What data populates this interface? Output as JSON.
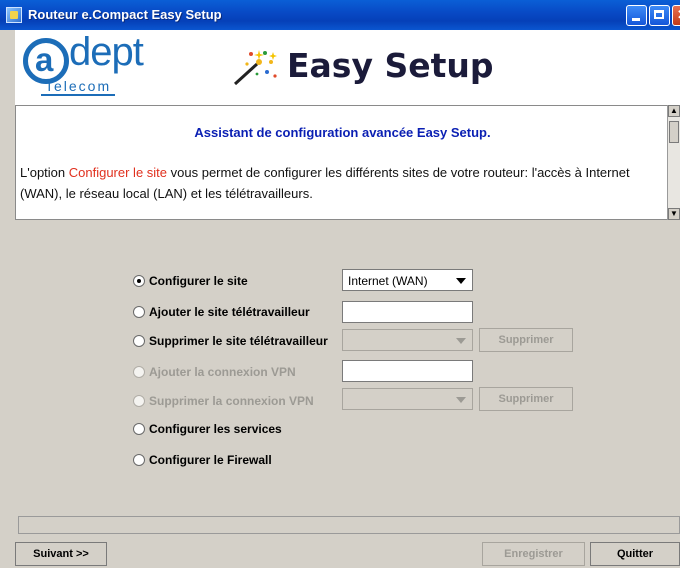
{
  "window": {
    "title": "Routeur e.Compact Easy Setup"
  },
  "header": {
    "logo_main": "dept",
    "logo_letter": "a",
    "logo_sub": "Telecom",
    "heading": "Easy Setup",
    "wand_icon": "magic-wand-sparkle-icon"
  },
  "info": {
    "heading": "Assistant de configuration avancée Easy Setup.",
    "para_prefix": "L'option ",
    "para_highlight": "Configurer le site",
    "para_suffix": " vous permet de configurer les différents sites de votre routeur: l'accès à Internet (WAN), le réseau local (LAN) et les télétravailleurs.",
    "highlight_color": "#e0301e"
  },
  "options": [
    {
      "label": "Configurer le site",
      "selected": true,
      "enabled": true
    },
    {
      "label": "Ajouter le site télétravailleur",
      "selected": false,
      "enabled": true
    },
    {
      "label": "Supprimer le site télétravailleur",
      "selected": false,
      "enabled": true
    },
    {
      "label": "Ajouter la connexion VPN",
      "selected": false,
      "enabled": false
    },
    {
      "label": "Supprimer la connexion VPN",
      "selected": false,
      "enabled": false
    },
    {
      "label": "Configurer les services",
      "selected": false,
      "enabled": true
    },
    {
      "label": "Configurer le Firewall",
      "selected": false,
      "enabled": true
    }
  ],
  "site_combo": {
    "value": "Internet (WAN)"
  },
  "buttons": {
    "supprimer_1": "Supprimer",
    "supprimer_2": "Supprimer",
    "suivant": "Suivant >>",
    "enregistrer": "Enregistrer",
    "quitter": "Quitter"
  },
  "colors": {
    "titlebar": "#0848c4",
    "heading_blue": "#0a1fb3",
    "logo_blue": "#1c6db8"
  }
}
